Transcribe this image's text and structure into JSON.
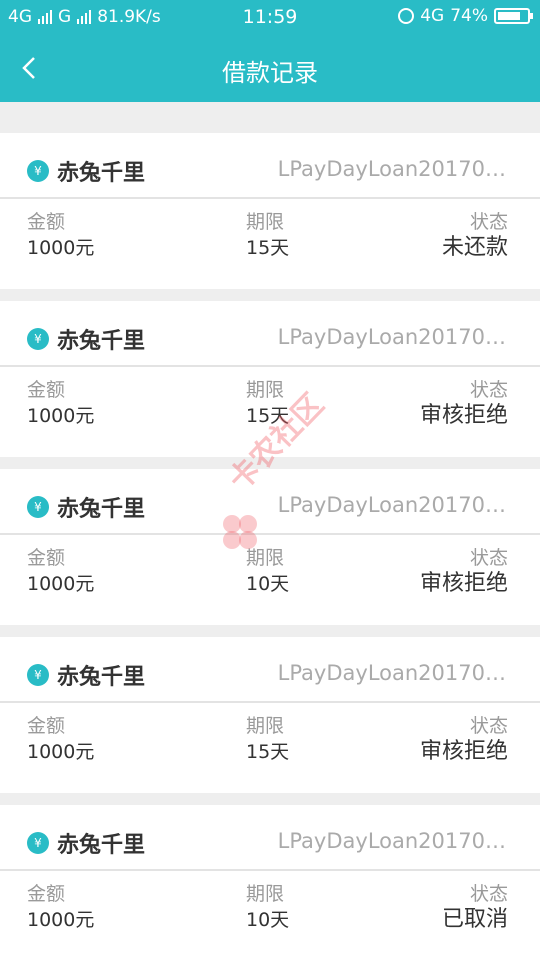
{
  "status_bar": {
    "network1": "4G",
    "network2": "G",
    "speed": "81.9K/s",
    "time": "11:59",
    "network3": "4G",
    "battery": "74%"
  },
  "nav": {
    "title": "借款记录"
  },
  "labels": {
    "amount": "金额",
    "term": "期限",
    "status": "状态"
  },
  "records": [
    {
      "product": "赤兔千里",
      "loan_id": "LPayDayLoan20170…",
      "amount": "1000元",
      "term": "15天",
      "status": "未还款"
    },
    {
      "product": "赤兔千里",
      "loan_id": "LPayDayLoan20170…",
      "amount": "1000元",
      "term": "15天",
      "status": "审核拒绝"
    },
    {
      "product": "赤兔千里",
      "loan_id": "LPayDayLoan20170…",
      "amount": "1000元",
      "term": "10天",
      "status": "审核拒绝"
    },
    {
      "product": "赤兔千里",
      "loan_id": "LPayDayLoan20170…",
      "amount": "1000元",
      "term": "15天",
      "status": "审核拒绝"
    },
    {
      "product": "赤兔千里",
      "loan_id": "LPayDayLoan20170…",
      "amount": "1000元",
      "term": "10天",
      "status": "已取消"
    }
  ],
  "watermark": {
    "text": "卡农社区"
  },
  "colors": {
    "accent": "#29bcc6",
    "background": "#eeeeee"
  }
}
